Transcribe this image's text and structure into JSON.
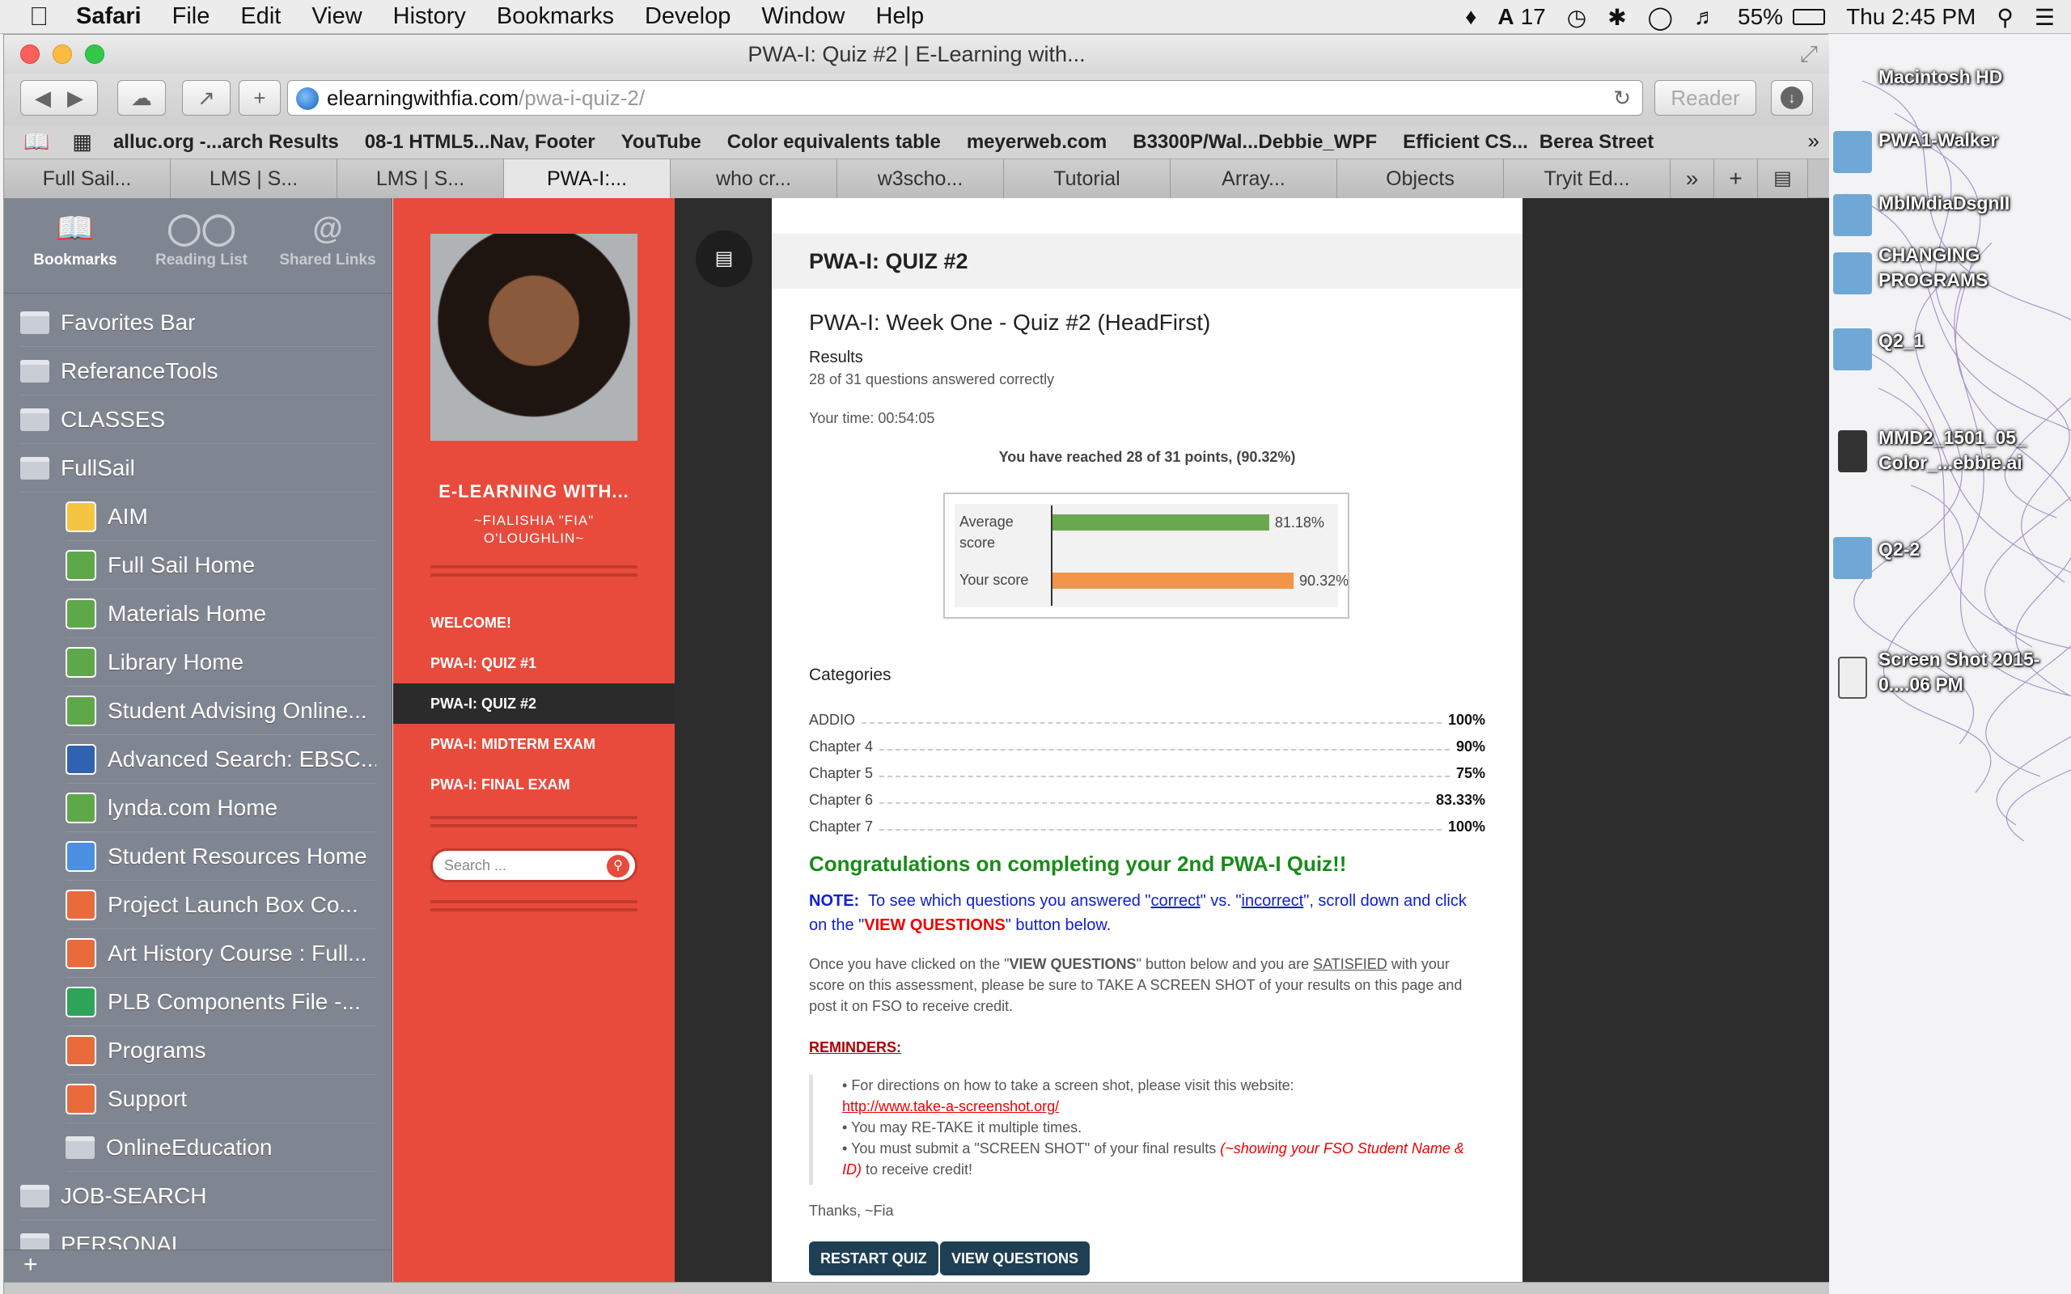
{
  "menubar": {
    "app": "Safari",
    "items": [
      "File",
      "Edit",
      "View",
      "History",
      "Bookmarks",
      "Develop",
      "Window",
      "Help"
    ],
    "status": {
      "adobe_count": "17",
      "battery": "55%",
      "clock": "Thu 2:45 PM"
    }
  },
  "window": {
    "title": "PWA-I: Quiz #2 | E-Learning with...",
    "url_host": "elearningwithfia.com",
    "url_path": "/pwa-i-quiz-2/",
    "reader_label": "Reader"
  },
  "bookmarks_bar": [
    "alluc.org -...arch Results",
    "08-1 HTML5...Nav, Footer",
    "YouTube",
    "Color equivalents table",
    "meyerweb.com",
    "B3300P/Wal...Debbie_WPF",
    "Efficient CS...",
    "Berea Street"
  ],
  "tabs": [
    "Full Sail...",
    "LMS | S...",
    "LMS | S...",
    "PWA-I:...",
    "who cr...",
    "w3scho...",
    "Tutorial",
    "Array...",
    "Objects",
    "Tryit Ed..."
  ],
  "sidebar": {
    "tabs": [
      "Bookmarks",
      "Reading List",
      "Shared Links"
    ],
    "folders_top": [
      "Favorites Bar",
      "ReferanceTools",
      "CLASSES",
      "FullSail"
    ],
    "children": [
      {
        "label": "AIM",
        "color": "#f5c542"
      },
      {
        "label": "Full Sail Home",
        "color": "#5fa84a"
      },
      {
        "label": "Materials Home",
        "color": "#5fa84a"
      },
      {
        "label": "Library Home",
        "color": "#5fa84a"
      },
      {
        "label": "Student Advising Online...",
        "color": "#5fa84a"
      },
      {
        "label": "Advanced Search: EBSC...",
        "color": "#2f63b0"
      },
      {
        "label": "lynda.com Home",
        "color": "#5fa84a"
      },
      {
        "label": "Student Resources Home",
        "color": "#4a90e2"
      },
      {
        "label": "Project Launch Box Co...",
        "color": "#e86b3c"
      },
      {
        "label": "Art History Course : Full...",
        "color": "#e86b3c"
      },
      {
        "label": "PLB Components File -...",
        "color": "#2ea35a"
      },
      {
        "label": "Programs",
        "color": "#e86b3c"
      },
      {
        "label": "Support",
        "color": "#e86b3c"
      },
      {
        "label": "OnlineEducation",
        "color": ""
      }
    ],
    "folders_bottom": [
      "JOB-SEARCH",
      "PERSONAL"
    ]
  },
  "site": {
    "title": "E-LEARNING WITH...",
    "subtitle": "~FIALISHIA \"FIA\" O'LOUGHLIN~",
    "nav": [
      "WELCOME!",
      "PWA-I: QUIZ #1",
      "PWA-I: QUIZ #2",
      "PWA-I: MIDTERM EXAM",
      "PWA-I: FINAL EXAM"
    ],
    "search_placeholder": "Search ..."
  },
  "entry": {
    "heading": "PWA-I: QUIZ #2",
    "quiz_title": "PWA-I: Week One - Quiz #2 (HeadFirst)",
    "results_label": "Results",
    "answered": "28 of 31 questions answered correctly",
    "time": "Your time: 00:54:05",
    "points": "You have reached 28 of 31 points, (90.32%)",
    "categories_label": "Categories",
    "categories": [
      {
        "name": "ADDIO",
        "pct": "100%"
      },
      {
        "name": "Chapter 4",
        "pct": "90%"
      },
      {
        "name": "Chapter 5",
        "pct": "75%"
      },
      {
        "name": "Chapter 6",
        "pct": "83.33%"
      },
      {
        "name": "Chapter 7",
        "pct": "100%"
      }
    ],
    "congrats": "Congratulations on completing your 2nd PWA-I Quiz!!",
    "note": {
      "label": "NOTE:",
      "pre": "To see which questions you answered \"",
      "correct": "correct",
      "mid": "\" vs. \"",
      "incorrect": "incorrect",
      "post": "\", scroll down and click on the \"",
      "view": "VIEW QUESTIONS",
      "end": "\" button below."
    },
    "instruct": {
      "a": "Once you have clicked on the \"",
      "b": "VIEW QUESTIONS",
      "c": "\" button below and you are ",
      "d": "SATISFIED",
      "e": " with your score on this assessment, please be sure to TAKE A SCREEN SHOT of your results on this page and post it on FSO to receive credit."
    },
    "reminders_label": "REMINDERS:",
    "reminders": {
      "r1": "For directions on how to take a screen shot, please visit this website:",
      "r1_link": "http://www.take-a-screenshot.org/",
      "r2": "You may RE-TAKE it multiple times.",
      "r3a": "You must submit a \"SCREEN SHOT\" of your final results ",
      "r3b": "(~showing your FSO Student Name & ID)",
      "r3c": " to receive credit!"
    },
    "thanks": "Thanks, ~Fia",
    "buttons": {
      "restart": "RESTART QUIZ",
      "view": "VIEW QUESTIONS"
    }
  },
  "chart_data": {
    "type": "bar",
    "orientation": "horizontal",
    "categories": [
      "Average score",
      "Your score"
    ],
    "values": [
      81.18,
      90.32
    ],
    "labels": [
      "81.18%",
      "90.32%"
    ],
    "colors": [
      "#6aa84f",
      "#f0954a"
    ],
    "xlim": [
      0,
      100
    ]
  },
  "desktop": {
    "icons": [
      "Macintosh HD",
      "PWA1-Walker",
      "MblMdiaDsgnII",
      "CHANGING PROGRAMS",
      "Q2_1",
      "MMD2_1501_05_ Color_...ebbie.ai",
      "Q2-2",
      "Screen Shot 2015-0....06 PM"
    ]
  }
}
